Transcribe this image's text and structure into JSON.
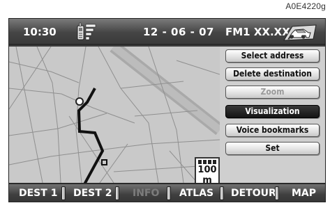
{
  "figure_code": "A0E4220g",
  "status_bar": {
    "time": "10:30",
    "date": "12 - 06 - 07",
    "radio": "FM1 XX.XX",
    "icons": [
      "phone-signal-icon",
      "navigation-car-icon"
    ]
  },
  "menu": {
    "items": [
      {
        "label": "Select address",
        "state": "normal"
      },
      {
        "label": "Delete destination",
        "state": "normal"
      },
      {
        "label": "Zoom",
        "state": "disabled"
      },
      {
        "label": "Visualization",
        "state": "selected"
      },
      {
        "label": "Voice bookmarks",
        "state": "normal"
      },
      {
        "label": "Set",
        "state": "normal"
      }
    ]
  },
  "map": {
    "speed_limit": "100",
    "speed_unit": "m"
  },
  "bottom_bar": {
    "items": [
      {
        "label": "DEST 1",
        "state": "normal"
      },
      {
        "label": "DEST 2",
        "state": "normal"
      },
      {
        "label": "INFO",
        "state": "disabled"
      },
      {
        "label": "ATLAS",
        "state": "normal"
      },
      {
        "label": "DETOUR",
        "state": "normal"
      },
      {
        "label": "MAP",
        "state": "normal"
      }
    ]
  },
  "colors": {
    "bar_dark": "#3a3a3a",
    "map_bg": "#c9c9c9",
    "route": "#111111",
    "selected_btn": "#1a1a1a"
  }
}
